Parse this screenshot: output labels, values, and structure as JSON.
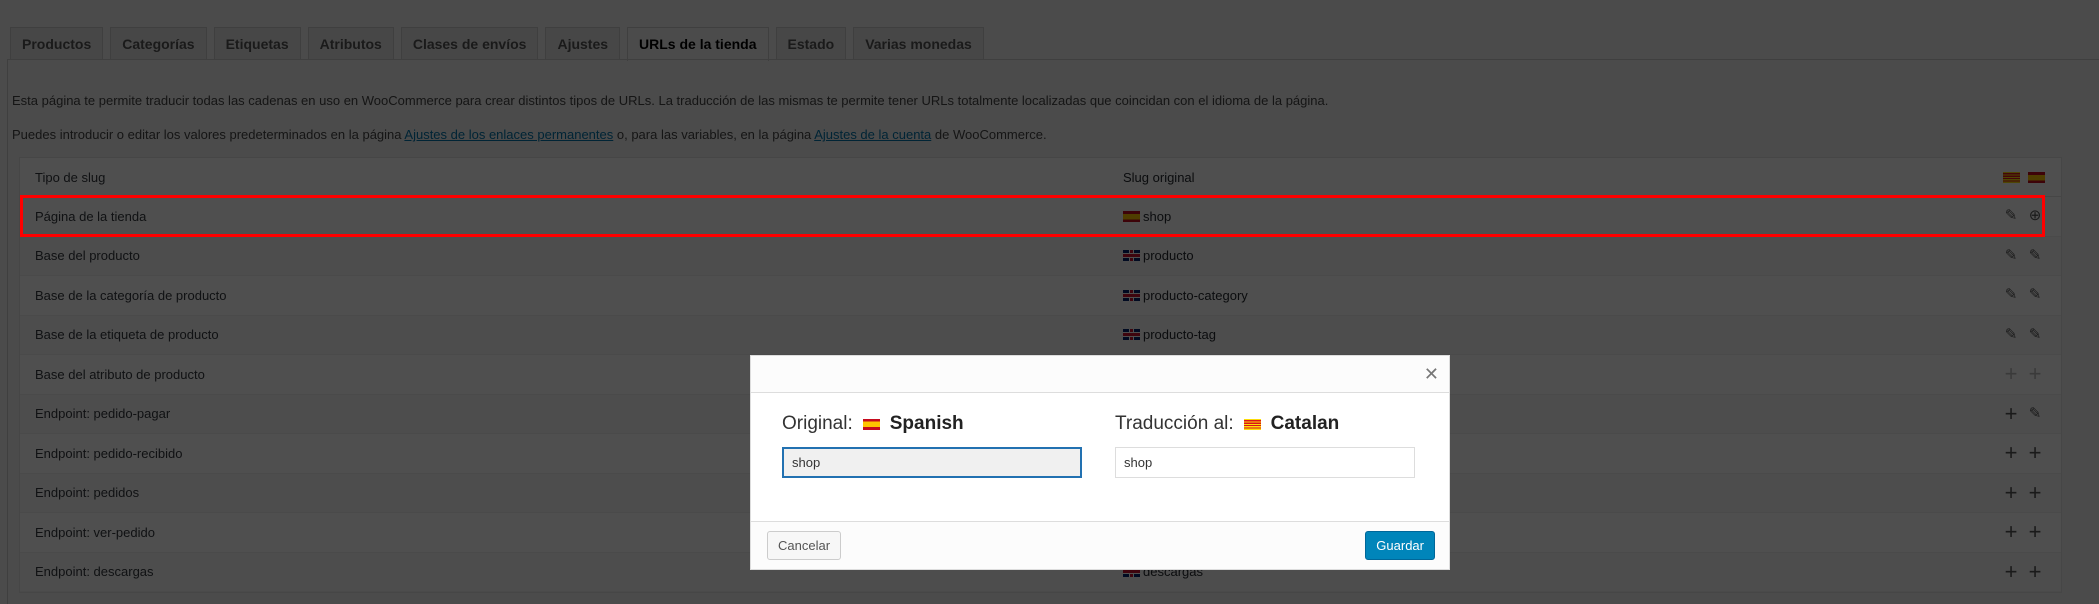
{
  "tabs": [
    "Productos",
    "Categorías",
    "Etiquetas",
    "Atributos",
    "Clases de envíos",
    "Ajustes",
    "URLs de la tienda",
    "Estado",
    "Varias monedas"
  ],
  "active_tab": 6,
  "intro": {
    "line1": "Esta página te permite traducir todas las cadenas en uso en WooCommerce para crear distintos tipos de URLs. La traducción de las mismas te permite tener URLs totalmente localizadas que coincidan con el idioma de la página.",
    "line2_a": "Puedes introducir o editar los valores predeterminados en la página ",
    "link1": "Ajustes de los enlaces permanentes",
    "line2_b": " o, para las variables, en la página ",
    "link2": "Ajustes de la cuenta",
    "line2_c": " de WooCommerce."
  },
  "table": {
    "headers": {
      "type": "Tipo de slug",
      "original": "Slug original"
    },
    "rows": [
      {
        "type": "Página de la tienda",
        "flag": "es",
        "slug": "shop",
        "actions": [
          "pencil",
          "globe"
        ]
      },
      {
        "type": "Base del producto",
        "flag": "uk",
        "slug": "producto",
        "actions": [
          "pencil",
          "pencil"
        ]
      },
      {
        "type": "Base de la categoría de producto",
        "flag": "uk",
        "slug": "producto-category",
        "actions": [
          "pencil",
          "pencil"
        ]
      },
      {
        "type": "Base de la etiqueta de producto",
        "flag": "uk",
        "slug": "producto-tag",
        "actions": [
          "pencil",
          "pencil"
        ]
      },
      {
        "type": "Base del atributo de producto",
        "flag": "",
        "slug": "",
        "actions": [
          "plus",
          "plus"
        ]
      },
      {
        "type": "Endpoint: pedido-pagar",
        "flag": "",
        "slug": "",
        "actions": [
          "plus",
          "pencil"
        ]
      },
      {
        "type": "Endpoint: pedido-recibido",
        "flag": "",
        "slug": "",
        "actions": [
          "plus",
          "plus"
        ]
      },
      {
        "type": "Endpoint: pedidos",
        "flag": "",
        "slug": "",
        "actions": [
          "plus",
          "plus"
        ]
      },
      {
        "type": "Endpoint: ver-pedido",
        "flag": "",
        "slug": "",
        "actions": [
          "plus",
          "plus"
        ]
      },
      {
        "type": "Endpoint: descargas",
        "flag": "uk",
        "slug": "descargas",
        "actions": [
          "plus",
          "plus"
        ]
      }
    ]
  },
  "modal": {
    "original_label": "Original:",
    "original_lang": "Spanish",
    "translation_label": "Traducción al:",
    "translation_lang": "Catalan",
    "original_value": "shop",
    "translation_value": "shop",
    "cancel": "Cancelar",
    "save": "Guardar"
  },
  "colors": {
    "highlight": "#ff0000",
    "primary": "#0085ba"
  }
}
